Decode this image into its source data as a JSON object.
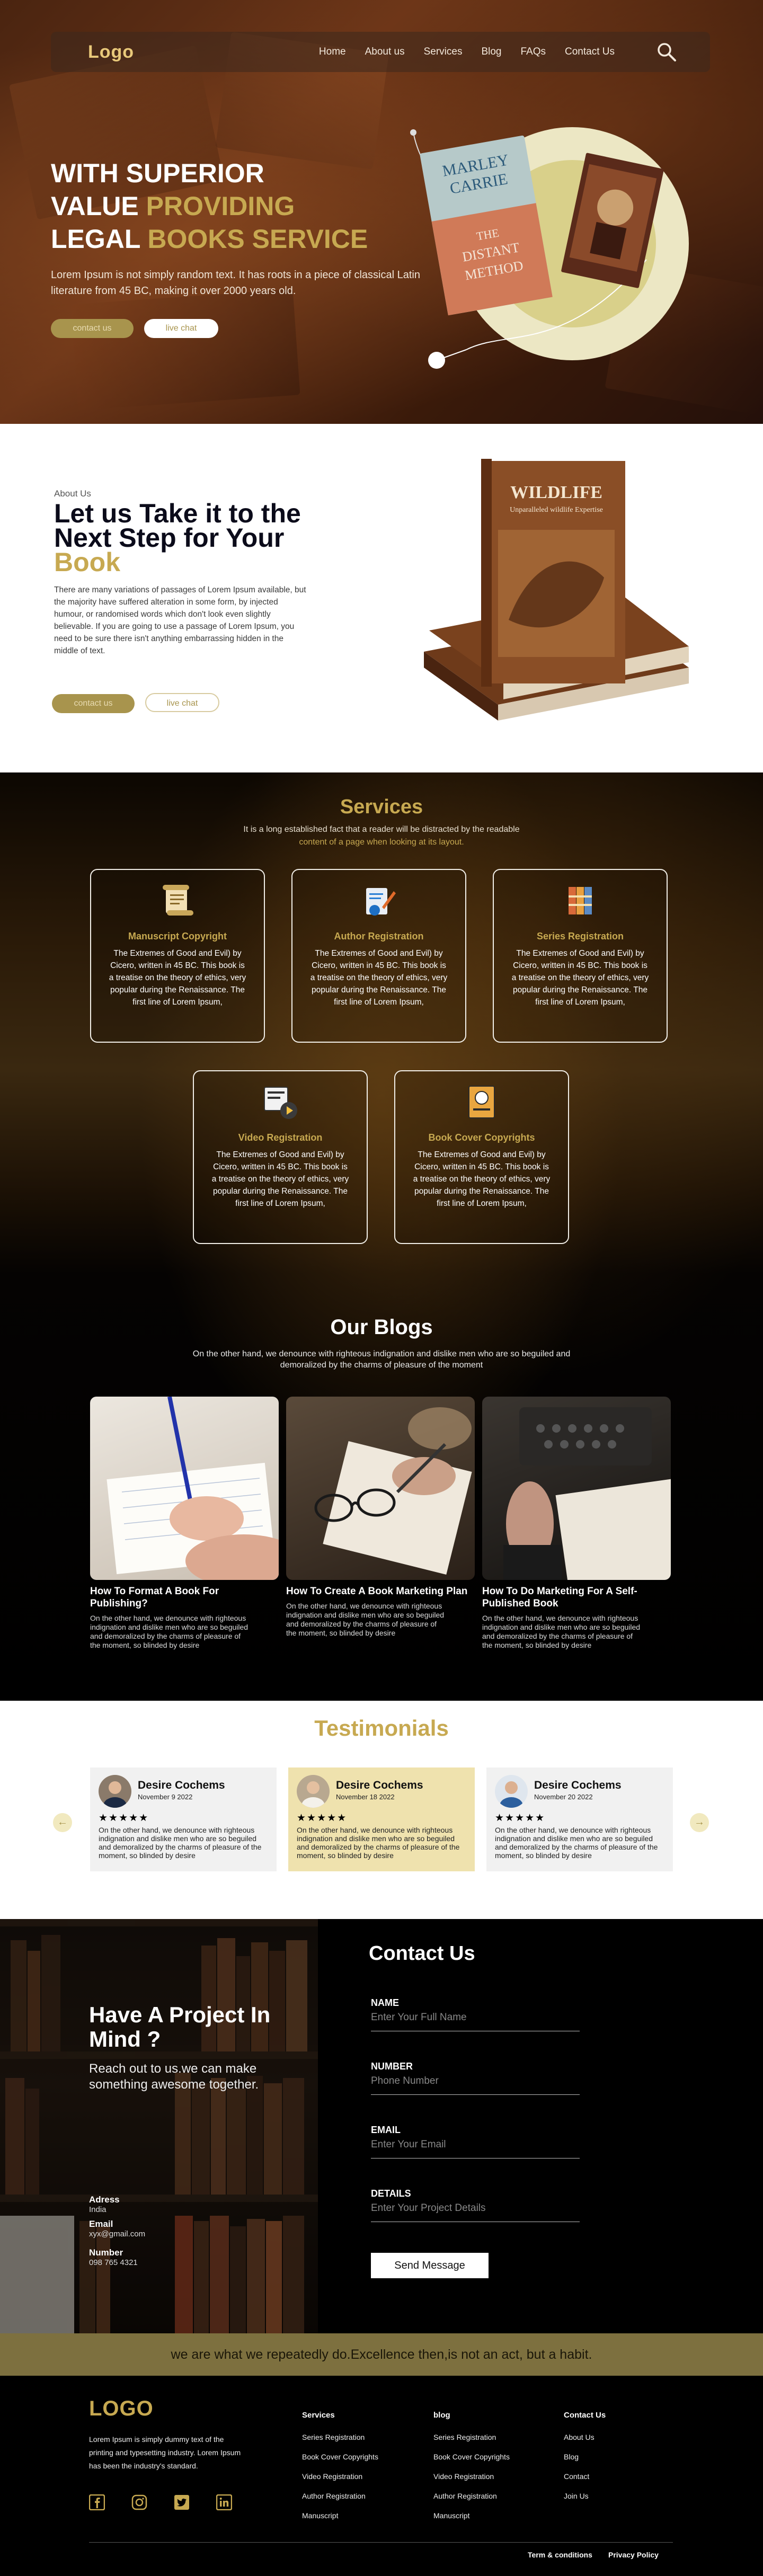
{
  "nav": {
    "logo": "Logo",
    "items": [
      "Home",
      "About us",
      "Services",
      "Blog",
      "FAQs",
      "Contact Us"
    ]
  },
  "hero": {
    "title_line1": "WITH SUPERIOR",
    "title_line2a": "VALUE ",
    "title_line2b": "PROVIDING",
    "title_line3a": "LEGAL ",
    "title_line3b": "BOOKS SERVICE",
    "description": "Lorem Ipsum is not simply random text. It has roots in a piece of classical Latin literature from 45 BC, making it over 2000 years old.",
    "primary_button": "contact us",
    "secondary_button": "live chat",
    "book1_author": "MARLEY CARRIE",
    "book1_title": "THE DISTANT METHOD"
  },
  "about": {
    "subtitle": "About Us",
    "title_a": "Let us Take it to the Next Step  for Your ",
    "title_b": "Book",
    "description": "There are many variations of passages of Lorem Ipsum available, but the majority have suffered alteration in some form, by injected humour, or randomised words which don't look even slightly believable. If you are going to use a passage of Lorem Ipsum, you need to be sure there isn't anything embarrassing hidden in the middle of text.",
    "primary_button": "contact us",
    "secondary_button": "live chat",
    "book_title": "WILDLIFE",
    "book_subtitle": "Unparalleled wildlife Expertise"
  },
  "services": {
    "title": "Services",
    "desc_a": "It is a long established fact that a reader will be distracted by the readable",
    "desc_b": "content of a page when looking at its layout.",
    "items": [
      {
        "title": "Manuscript Copyright",
        "text": "The Extremes of Good and Evil) by Cicero, written in 45 BC. This book is a treatise on the theory of ethics, very popular during the Renaissance. The first line of Lorem Ipsum,"
      },
      {
        "title": "Author Registration",
        "text": "The Extremes of Good and Evil) by Cicero, written in 45 BC. This book is a treatise on the theory of ethics, very popular during the Renaissance. The first line of Lorem Ipsum,"
      },
      {
        "title": "Series Registration",
        "text": "The Extremes of Good and Evil) by Cicero, written in 45 BC. This book is a treatise on the theory of ethics, very popular during the Renaissance. The first line of Lorem Ipsum,"
      },
      {
        "title": "Video Registration",
        "text": "The Extremes of Good and Evil) by Cicero, written in 45 BC. This book is a treatise on the theory of ethics, very popular during the Renaissance. The first line of Lorem Ipsum,"
      },
      {
        "title": "Book Cover Copyrights",
        "text": "The Extremes of Good and Evil) by Cicero, written in 45 BC. This book is a treatise on the theory of ethics, very popular during the Renaissance. The first line of Lorem Ipsum,"
      }
    ]
  },
  "blogs": {
    "title": "Our Blogs",
    "description": "On the other hand, we denounce with righteous indignation and dislike men who are so beguiled and demoralized by the charms of pleasure of the moment",
    "items": [
      {
        "title": "How To Format A Book For Publishing?",
        "text": "On the other hand, we denounce with righteous indignation and dislike men who are so beguiled and demoralized by the charms of pleasure of the moment, so blinded by desire"
      },
      {
        "title": "How To Create A Book Marketing Plan",
        "text": "On the other hand, we denounce with righteous indignation and dislike men who are so beguiled and demoralized by the charms of pleasure of the moment, so blinded by desire"
      },
      {
        "title": "How To Do Marketing For A Self-Published Book",
        "text": "On the other hand, we denounce with righteous indignation and dislike men who are so beguiled and demoralized by the charms of pleasure of the moment, so blinded by desire"
      }
    ]
  },
  "testimonials": {
    "title": "Testimonials",
    "prev": "←",
    "next": "→",
    "items": [
      {
        "name": "Desire Cochems",
        "date": "November 9 2022",
        "stars": "★★★★★",
        "rating": 5,
        "text": "On the other hand, we denounce with righteous indignation and dislike men who are so beguiled and demoralized by the charms of pleasure of the moment, so blinded by desire"
      },
      {
        "name": "Desire Cochems",
        "date": "November 18 2022",
        "stars": "★★★★★",
        "rating": 5,
        "text": "On the other hand, we denounce with righteous indignation and dislike men who are so beguiled and demoralized by the charms of pleasure of the moment, so blinded by desire"
      },
      {
        "name": "Desire Cochems",
        "date": "November 20 2022",
        "stars": "★★★★★",
        "rating": 5,
        "text": "On the other hand, we denounce with righteous indignation and dislike men who are so beguiled and demoralized by the charms of pleasure of the moment, so blinded by desire"
      }
    ]
  },
  "contact": {
    "project_title": "Have A Project In Mind ?",
    "project_sub": "Reach out to us.we can make something awesome together.",
    "address_label": "Adress",
    "address_value": "India",
    "email_label": "Email",
    "email_value": "xyx@gmail.com",
    "number_label": "Number",
    "number_value": "098 765 4321",
    "form_title": "Contact Us",
    "fields": [
      {
        "label": "NAME",
        "placeholder": "Enter Your Full Name"
      },
      {
        "label": "NUMBER",
        "placeholder": "Phone Number"
      },
      {
        "label": "EMAIL",
        "placeholder": "Enter Your Email"
      },
      {
        "label": "DETAILS",
        "placeholder": "Enter Your Project Details"
      }
    ],
    "send_button": "Send Message"
  },
  "quote": "we are what we repeatedly do.Excellence then,is not an act, but a habit.",
  "footer": {
    "logo": "LOGO",
    "description": "Lorem Ipsum is simply dummy text of the printing and typesetting industry. Lorem Ipsum has been the industry's standard.",
    "columns": [
      {
        "heading": "Services",
        "links": [
          "Series Registration",
          "Book Cover Copyrights",
          "Video Registration",
          "Author Registration",
          "Manuscript"
        ]
      },
      {
        "heading": "blog",
        "links": [
          "Series Registration",
          "Book Cover Copyrights",
          "Video Registration",
          "Author Registration",
          "Manuscript"
        ]
      },
      {
        "heading": "Contact Us",
        "links": [
          "About Us",
          "Blog",
          "Contact",
          "Join Us"
        ]
      }
    ],
    "terms": "Term & conditions",
    "privacy": "Privacy Policy"
  },
  "colors": {
    "gold": "#c7a951",
    "dark_brown": "#4a2410",
    "quote_band": "#7d703f"
  }
}
